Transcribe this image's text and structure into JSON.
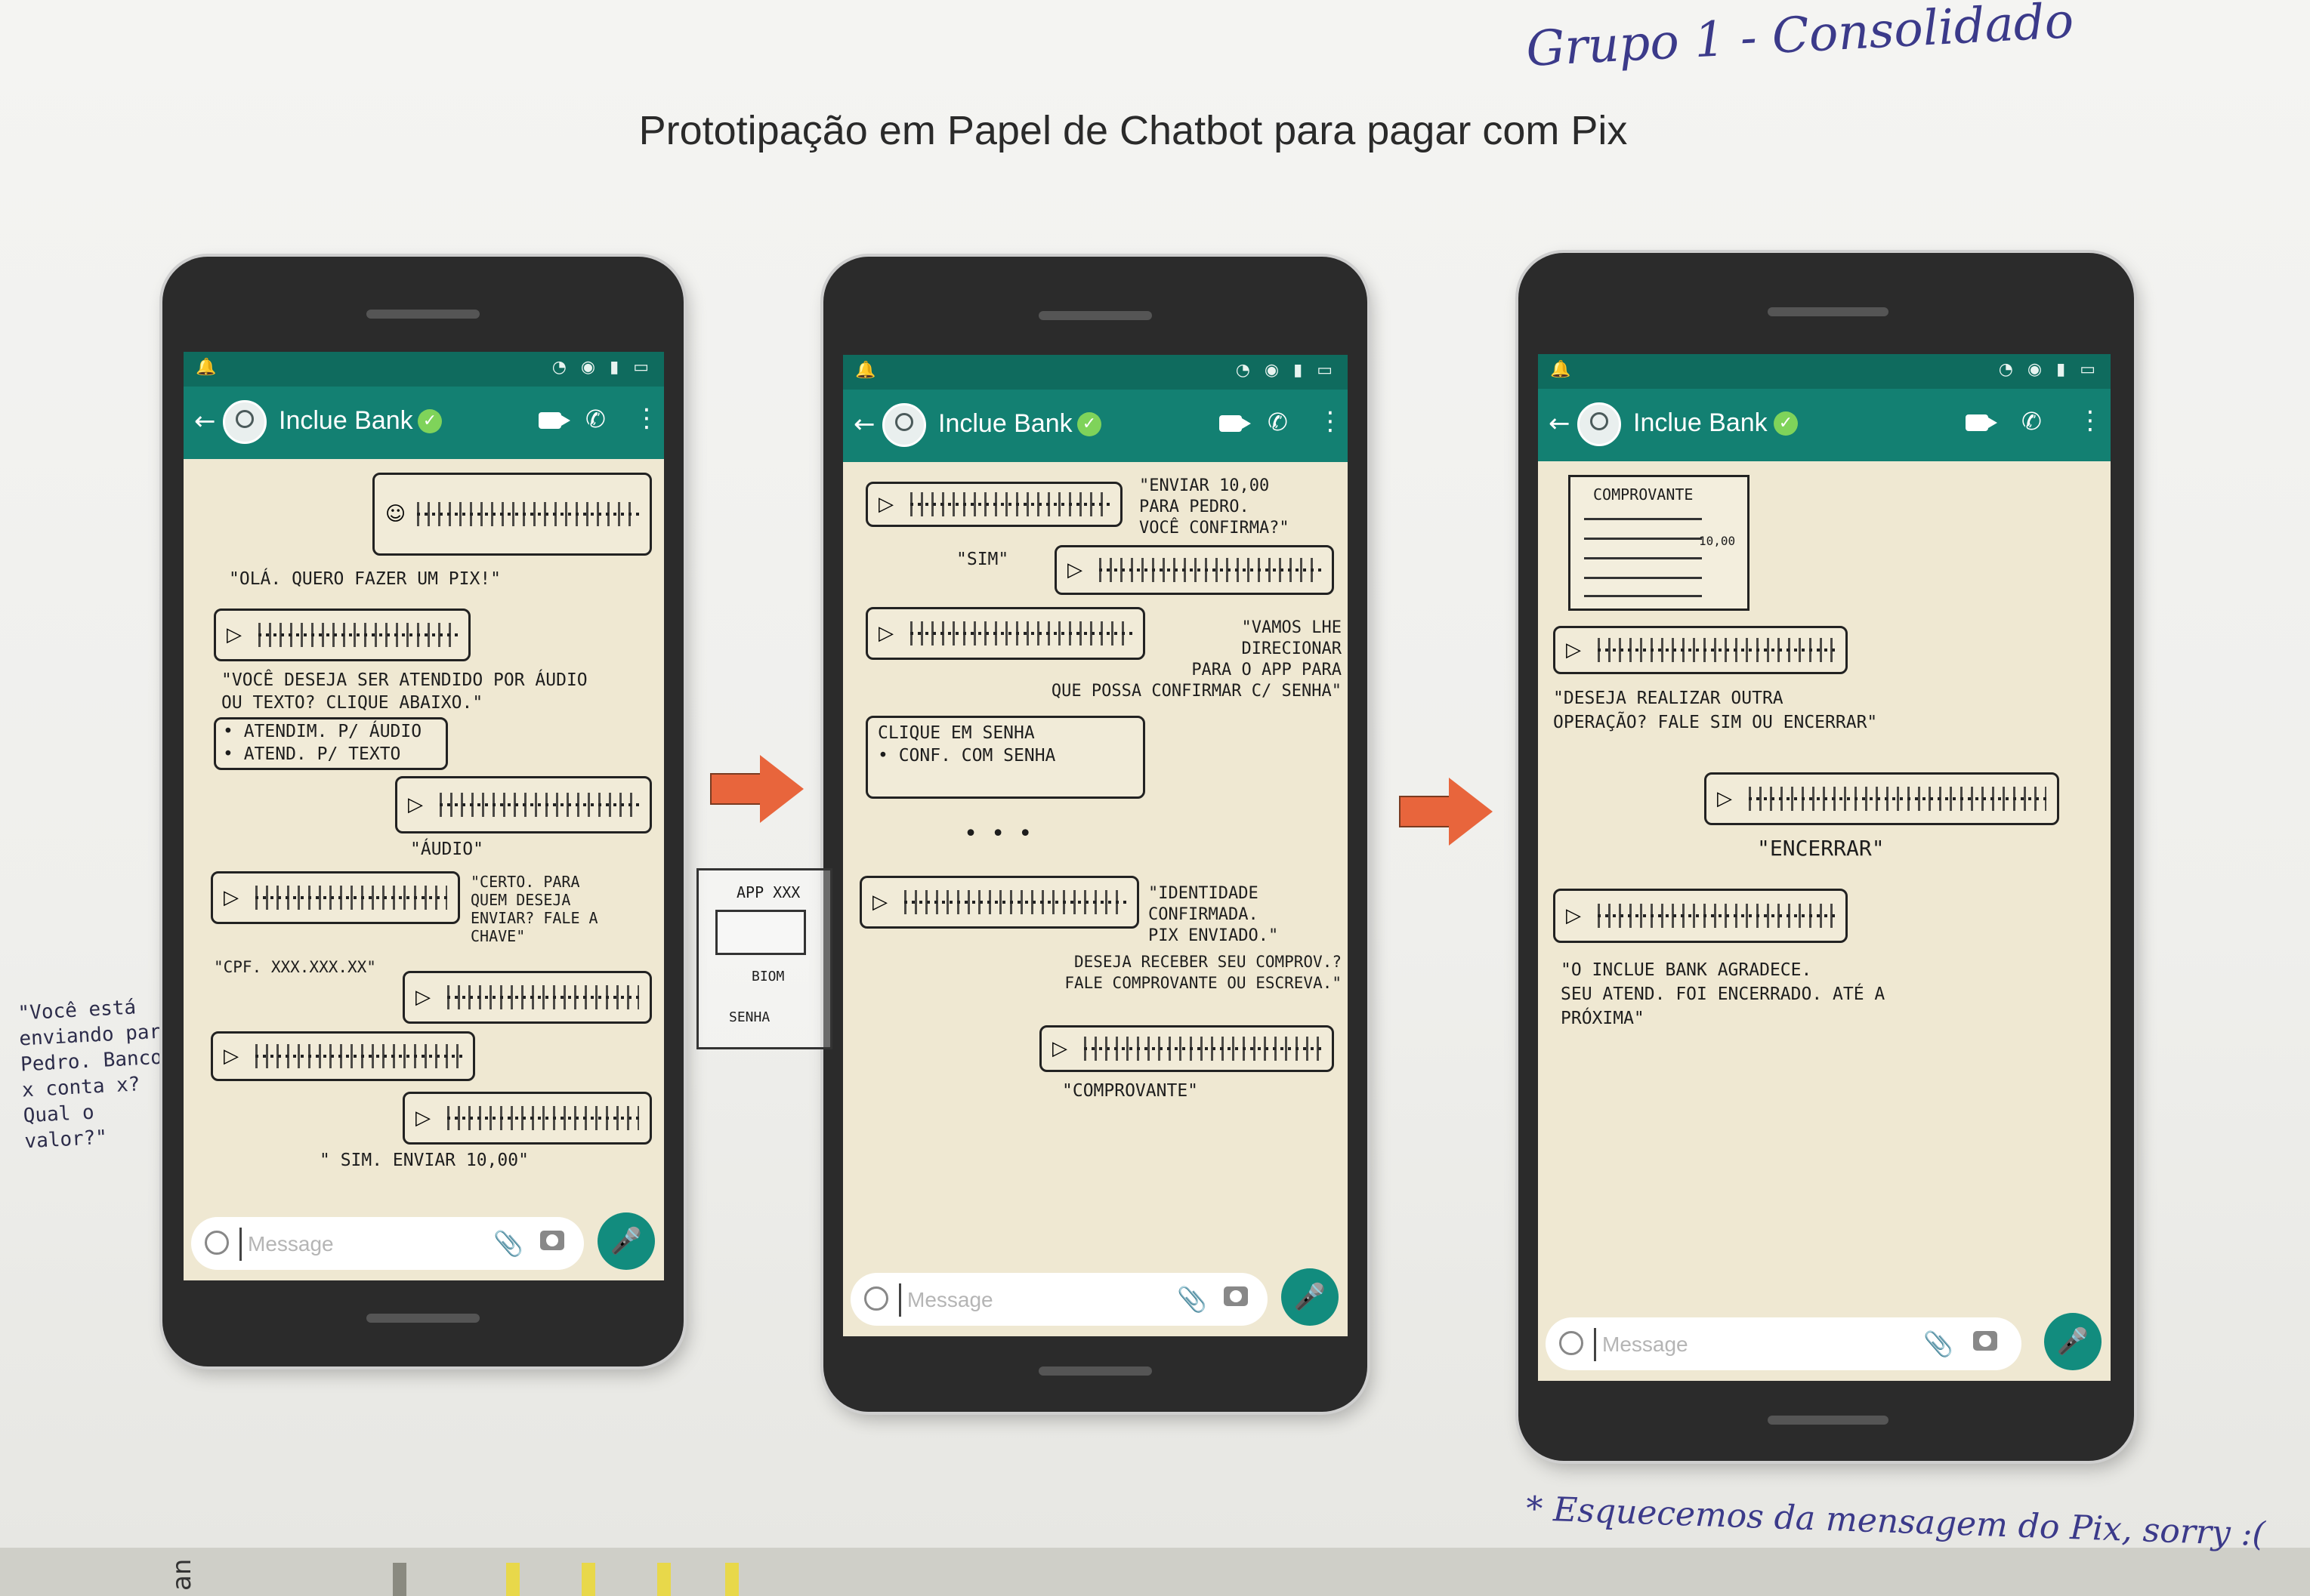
{
  "page": {
    "title": "Prototipação em Papel de Chatbot para pagar com Pix",
    "group_label": "Grupo 1 - Consolidado",
    "footer_note": "* Esquecemos da mensagem do Pix, sorry :(",
    "side_note": "\"Você está enviando para Pedro. Banco x conta x? Qual o valor?\"",
    "strip_text": "an"
  },
  "chat": {
    "contact_name": "Inclue Bank",
    "input_placeholder": "Message"
  },
  "icons": {
    "status": "◔ ◉ ▮ ▭",
    "bell": "🔔",
    "back": "←",
    "verified": "✓",
    "call": "✆",
    "menu": "⋮",
    "clip": "📎",
    "mic": "🎤",
    "play": "▷"
  },
  "screens": [
    {
      "captions": [
        "\"OLÁ. QUERO FAZER UM PIX!\"",
        "\"VOCÊ DESEJA SER ATENDIDO POR ÁUDIO\nOU TEXTO? CLIQUE ABAIXO.\"",
        "• ATENDIM. P/ ÁUDIO\n• ATEND. P/ TEXTO",
        "\"ÁUDIO\"",
        "\"CERTO. PARA\nQUEM DESEJA\nENVIAR? FALE A\nCHAVE\"",
        "\"CPF. XXX.XXX.XX\"",
        "\" SIM. ENVIAR 10,00\""
      ]
    },
    {
      "captions": [
        "\"ENVIAR 10,00\nPARA PEDRO.\nVOCÊ CONFIRMA?\"",
        "\"SIM\"",
        "\"VAMOS LHE\nDIRECIONAR\nPARA O APP PARA\nQUE POSSA CONFIRMAR C/ SENHA\"",
        "CLIQUE EM SENHA\n• CONF. COM SENHA",
        "APP XXX",
        "BIOM",
        "SENHA",
        "\"IDENTIDADE\nCONFIRMADA.\nPIX ENVIADO.\"",
        "DESEJA RECEBER SEU COMPROV.?\nFALE COMPROVANTE OU ESCREVA.\"",
        "\"COMPROVANTE\""
      ]
    },
    {
      "captions": [
        "COMPROVANTE",
        "10,00",
        "\"DESEJA REALIZAR OUTRA\nOPERAÇÃO? FALE SIM OU ENCERRAR\"",
        "\"ENCERRAR\"",
        "\"O INCLUE BANK AGRADECE.\nSEU ATEND. FOI ENCERRADO. ATÉ A\nPRÓXIMA\""
      ]
    }
  ]
}
